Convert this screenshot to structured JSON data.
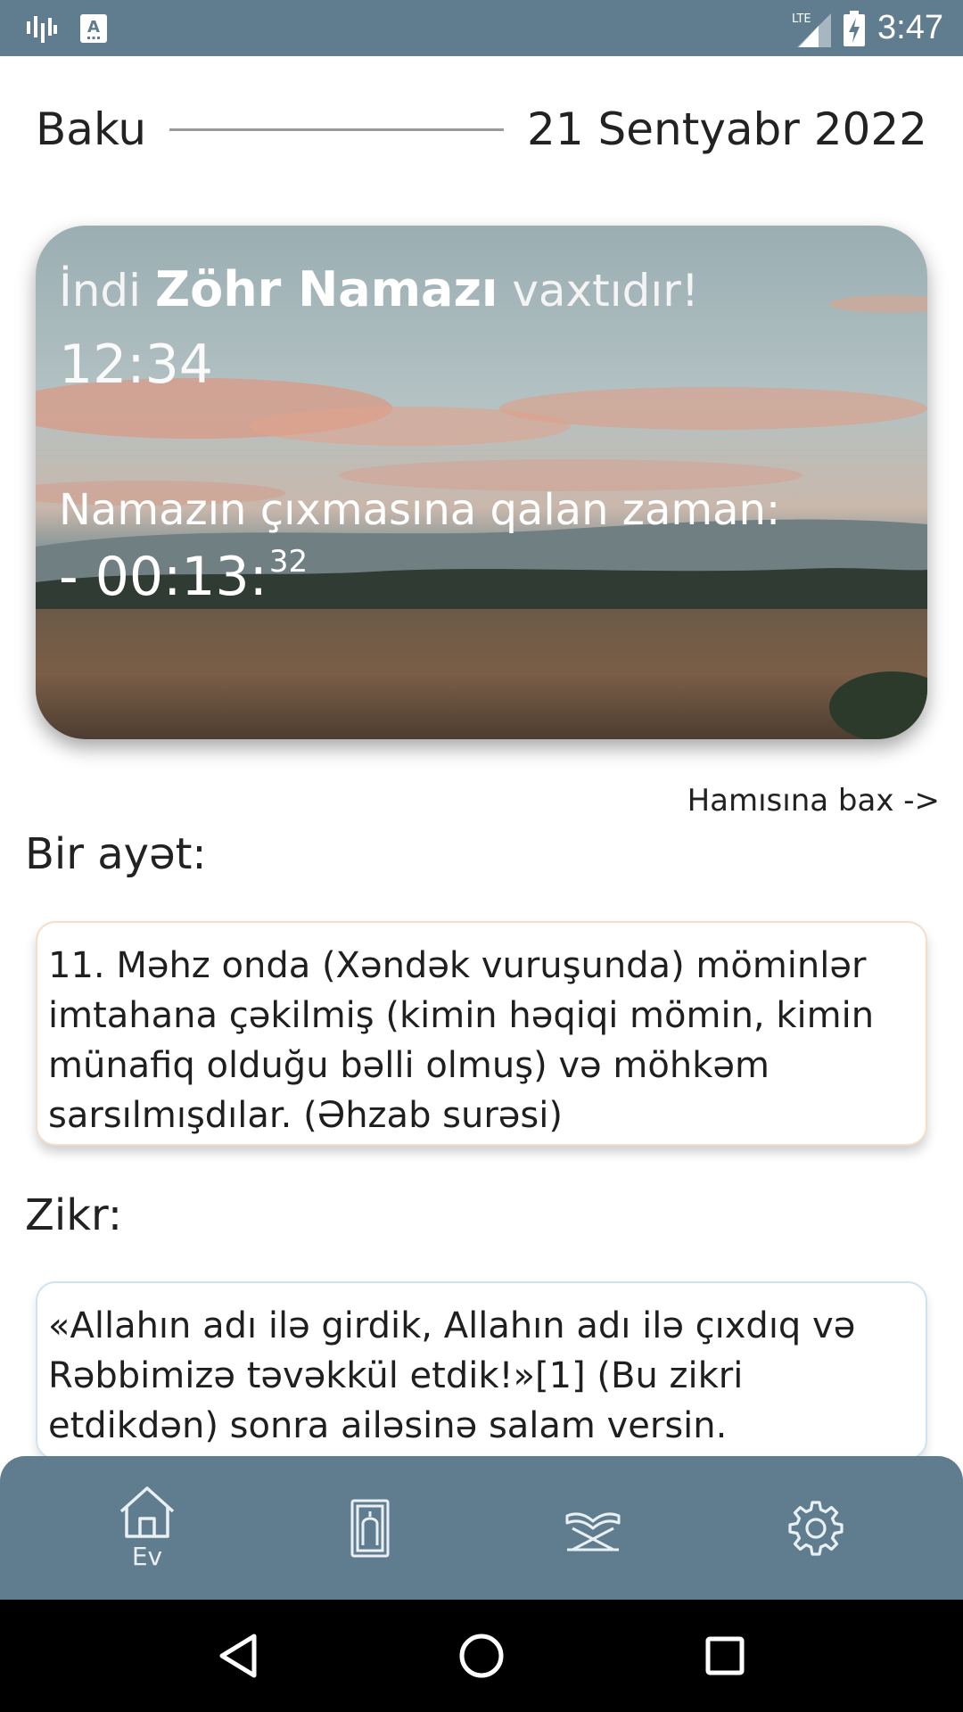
{
  "status_bar": {
    "time": "3:47",
    "network": "LTE",
    "icons": [
      "signal-bars-icon",
      "keyboard-a-icon",
      "lte-signal-icon",
      "battery-charging-icon"
    ]
  },
  "header": {
    "city": "Baku",
    "date": "21 Sentyabr 2022"
  },
  "prayer_card": {
    "prefix": "İndi",
    "prayer_name": "Zöhr Namazı",
    "suffix": "vaxtıdır!",
    "time": "12:34",
    "remaining_label": "Namazın çıxmasına qalan zaman:",
    "remaining_main": "- 00:13:",
    "remaining_seconds": "32"
  },
  "see_all": "Hamısına bax ->",
  "ayah": {
    "title": "Bir ayət:",
    "text": "11. Məhz onda (Xəndək vuruşunda) möminlər imtahana çəkilmiş (kimin həqiqi mömin, kimin münafiq olduğu bəlli olmuş) və möhkəm sarsılmışdılar. (Əhzab surəsi)"
  },
  "zikr": {
    "title": "Zikr:",
    "text": "«Allahın adı ilə girdik, Allahın adı ilə çıxdıq və Rəbbimizə təvəkkül etdik!»[1] (Bu zikri etdikdən) sonra ailəsinə salam versin."
  },
  "bottom_nav": {
    "items": [
      {
        "icon": "home-icon",
        "label": "Ev"
      },
      {
        "icon": "prayer-mat-icon"
      },
      {
        "icon": "quran-stand-icon"
      },
      {
        "icon": "gear-icon"
      }
    ]
  },
  "colors": {
    "primary": "#5f7d8f",
    "ayah_border": "#f7dcc6",
    "zikr_border": "#cfe3ef"
  }
}
